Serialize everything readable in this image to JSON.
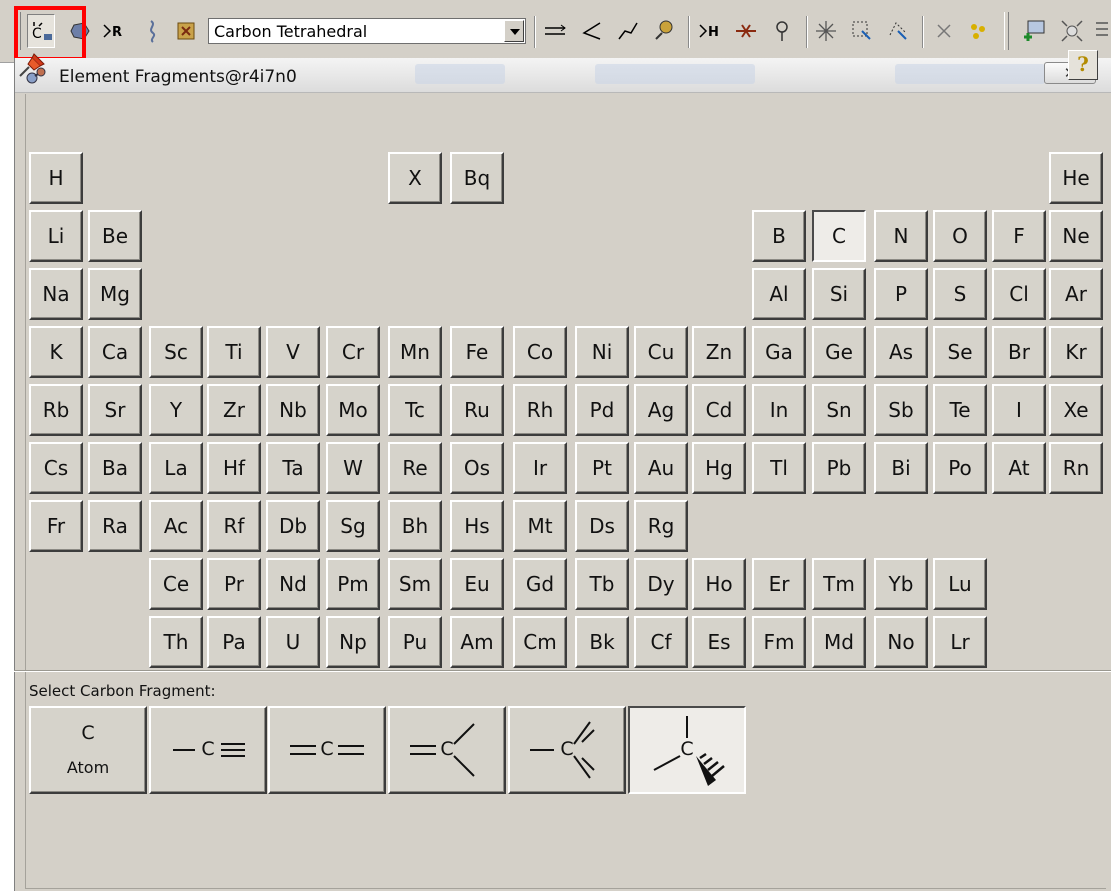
{
  "toolbar": {
    "fragment_dropdown_value": "Carbon Tetrahedral",
    "highlight_color": "#ff0000"
  },
  "window": {
    "title": "Element Fragments@r4i7n0",
    "close_label": "✕",
    "help_label": "?"
  },
  "periodic_table": {
    "selected": "C",
    "row1": [
      "H",
      "X",
      "Bq",
      "He"
    ],
    "row2": [
      "Li",
      "Be",
      "B",
      "C",
      "N",
      "O",
      "F",
      "Ne"
    ],
    "row3": [
      "Na",
      "Mg",
      "Al",
      "Si",
      "P",
      "S",
      "Cl",
      "Ar"
    ],
    "row4": [
      "K",
      "Ca",
      "Sc",
      "Ti",
      "V",
      "Cr",
      "Mn",
      "Fe",
      "Co",
      "Ni",
      "Cu",
      "Zn",
      "Ga",
      "Ge",
      "As",
      "Se",
      "Br",
      "Kr"
    ],
    "row5": [
      "Rb",
      "Sr",
      "Y",
      "Zr",
      "Nb",
      "Mo",
      "Tc",
      "Ru",
      "Rh",
      "Pd",
      "Ag",
      "Cd",
      "In",
      "Sn",
      "Sb",
      "Te",
      "I",
      "Xe"
    ],
    "row6": [
      "Cs",
      "Ba",
      "La",
      "Hf",
      "Ta",
      "W",
      "Re",
      "Os",
      "Ir",
      "Pt",
      "Au",
      "Hg",
      "Tl",
      "Pb",
      "Bi",
      "Po",
      "At",
      "Rn"
    ],
    "row7": [
      "Fr",
      "Ra",
      "Ac",
      "Rf",
      "Db",
      "Sg",
      "Bh",
      "Hs",
      "Mt",
      "Ds",
      "Rg"
    ],
    "lanthanides": [
      "Ce",
      "Pr",
      "Nd",
      "Pm",
      "Sm",
      "Eu",
      "Gd",
      "Tb",
      "Dy",
      "Ho",
      "Er",
      "Tm",
      "Yb",
      "Lu"
    ],
    "actinides": [
      "Th",
      "Pa",
      "U",
      "Np",
      "Pu",
      "Am",
      "Cm",
      "Bk",
      "Cf",
      "Es",
      "Fm",
      "Md",
      "No",
      "Lr"
    ]
  },
  "fragments": {
    "label": "Select Carbon Fragment:",
    "atom_symbol": "C",
    "atom_caption": "Atom",
    "center_symbol": "C",
    "selected": "tetrahedral"
  }
}
